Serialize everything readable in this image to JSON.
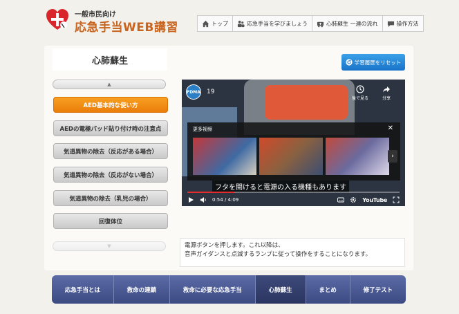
{
  "header": {
    "subtitle": "一般市民向け",
    "title": "応急手当WEB講習"
  },
  "top_nav": [
    {
      "label": "トップ",
      "icon": "home-icon"
    },
    {
      "label": "応急手当を学びましょう",
      "icon": "people-icon"
    },
    {
      "label": "心肺蘇生 一連の流れ",
      "icon": "ambulance-icon"
    },
    {
      "label": "操作方法",
      "icon": "chat-icon"
    }
  ],
  "sidebar": {
    "title": "心肺蘇生",
    "scroll_up": "▲",
    "scroll_down": "▼",
    "items": [
      {
        "label": "AED基本的な使い方",
        "active": true
      },
      {
        "label": "AEDの電極パッド貼り付け時の注意点",
        "active": false
      },
      {
        "label": "気道異物の除去（反応がある場合）",
        "active": false
      },
      {
        "label": "気道異物の除去（反応がない場合）",
        "active": false
      },
      {
        "label": "気道異物の除去（乳児の場合）",
        "active": false
      },
      {
        "label": "回復体位",
        "active": false
      }
    ]
  },
  "reset_button": {
    "label": "学習履歴をリセット"
  },
  "video": {
    "channel_badge": "FDMA",
    "title": "19",
    "watch_later": "後で見る",
    "share": "分享",
    "more_videos": "更多视频",
    "close": "✕",
    "next": "›",
    "subtitle": "フタを開けると電源の入る機種もあります",
    "time": "0:54 / 4:09",
    "progress": 0.22,
    "yt_logo": "YouTube"
  },
  "caption": {
    "line1": "電源ボタンを押します。これ以降は、",
    "line2": "音声ガイダンスと点滅するランプに従って操作をすることになります。"
  },
  "bottom_nav": [
    {
      "label": "応急手当とは",
      "active": false
    },
    {
      "label": "救命の連鎖",
      "active": false
    },
    {
      "label": "救命に必要な応急手当",
      "active": false
    },
    {
      "label": "心肺蘇生",
      "active": true
    },
    {
      "label": "まとめ",
      "active": false
    },
    {
      "label": "修了テスト",
      "active": false
    }
  ],
  "colors": {
    "accent_orange": "#f08c14",
    "reset_blue": "#1a73c8",
    "nav_blue": "#4a5890",
    "logo_red": "#d8262b"
  }
}
